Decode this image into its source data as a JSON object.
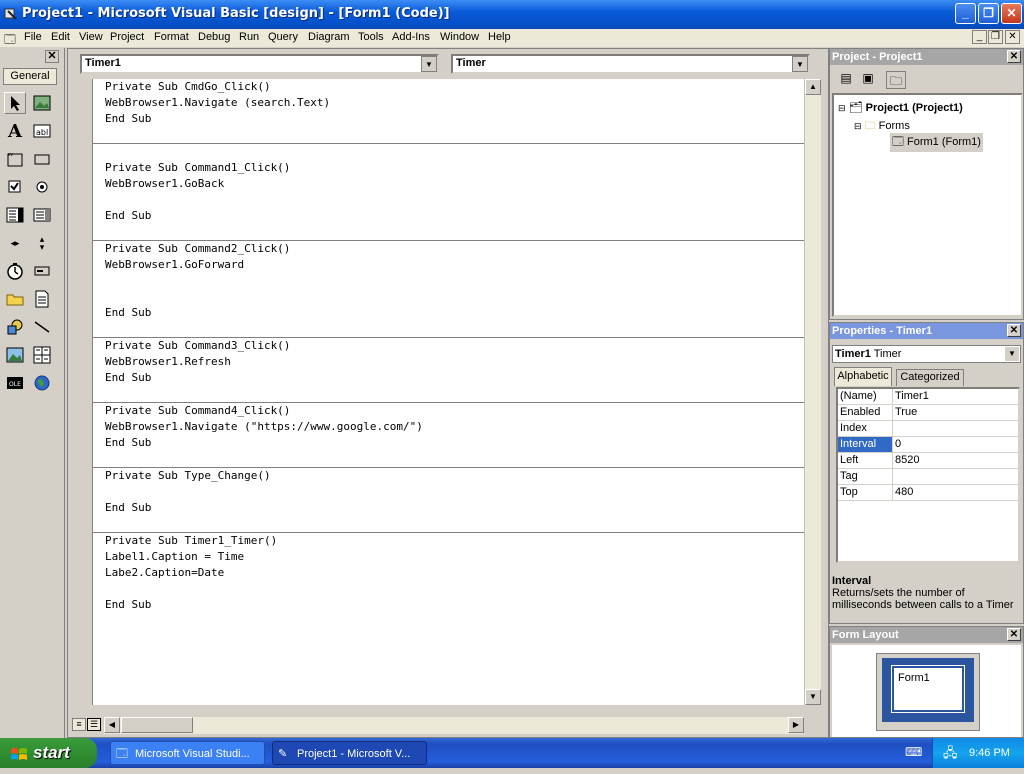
{
  "window": {
    "title": "Project1 - Microsoft Visual Basic [design] - [Form1 (Code)]"
  },
  "menu": [
    "File",
    "Edit",
    "View",
    "Project",
    "Format",
    "Debug",
    "Run",
    "Query",
    "Diagram",
    "Tools",
    "Add-Ins",
    "Window",
    "Help"
  ],
  "toolbox": {
    "tab_label": "General"
  },
  "code_window": {
    "object_combo": "Timer1",
    "procedure_combo": "Timer",
    "procedures": [
      [
        "Private Sub CmdGo_Click()",
        "WebBrowser1.Navigate (search.Text)",
        "End Sub",
        ""
      ],
      [
        "",
        "Private Sub Command1_Click()",
        "WebBrowser1.GoBack",
        "",
        "End Sub",
        ""
      ],
      [
        "Private Sub Command2_Click()",
        "WebBrowser1.GoForward",
        "",
        "",
        "End Sub",
        ""
      ],
      [
        "Private Sub Command3_Click()",
        "WebBrowser1.Refresh",
        "End Sub",
        ""
      ],
      [
        "Private Sub Command4_Click()",
        "WebBrowser1.Navigate (\"https://www.google.com/\")",
        "End Sub",
        ""
      ],
      [
        "Private Sub Type_Change()",
        "",
        "End Sub",
        ""
      ],
      [
        "Private Sub Timer1_Timer()",
        "Label1.Caption = Time",
        "Labe2.Caption=Date",
        "",
        "End Sub"
      ]
    ]
  },
  "project_panel": {
    "title": "Project - Project1",
    "root": "Project1 (Project1)",
    "folder": "Forms",
    "item": "Form1 (Form1)"
  },
  "properties_panel": {
    "title": "Properties - Timer1",
    "object_name": "Timer1",
    "object_type": "Timer",
    "tab_alpha": "Alphabetic",
    "tab_cat": "Categorized",
    "rows": [
      {
        "name": "(Name)",
        "value": "Timer1"
      },
      {
        "name": "Enabled",
        "value": "True"
      },
      {
        "name": "Index",
        "value": ""
      },
      {
        "name": "Interval",
        "value": "0"
      },
      {
        "name": "Left",
        "value": "8520"
      },
      {
        "name": "Tag",
        "value": ""
      },
      {
        "name": "Top",
        "value": "480"
      }
    ],
    "desc_title": "Interval",
    "desc_text": "Returns/sets the number of milliseconds between calls to a Timer"
  },
  "form_layout": {
    "title": "Form Layout",
    "form_label": "Form1"
  },
  "taskbar": {
    "start": "start",
    "tasks": [
      "Microsoft Visual Studi...",
      "Project1 - Microsoft V..."
    ],
    "clock": "9:46 PM"
  }
}
